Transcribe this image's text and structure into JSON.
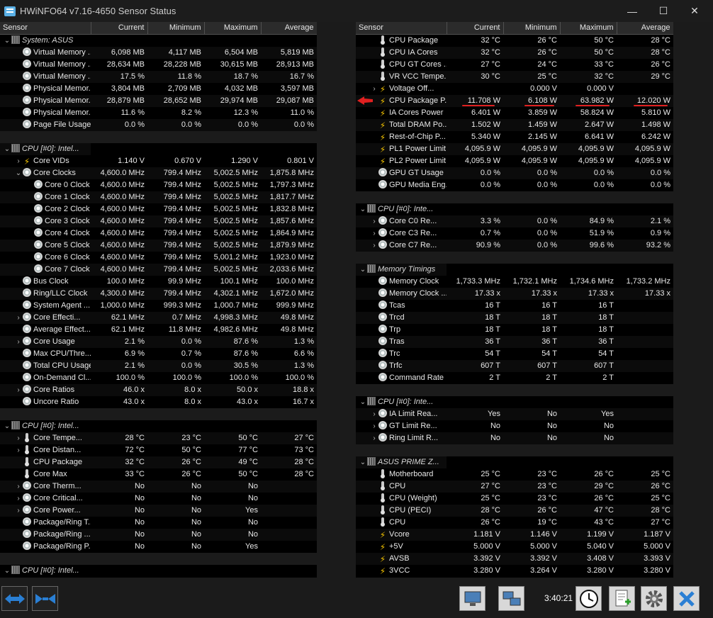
{
  "window": {
    "title": "HWiNFO64 v7.16-4650 Sensor Status",
    "minimize": "—",
    "maximize": "☐",
    "close": "✕"
  },
  "columns": [
    "Sensor",
    "Current",
    "Minimum",
    "Maximum",
    "Average"
  ],
  "left_rows": [
    {
      "t": "group",
      "name": "System: ASUS",
      "icon": "chip-icon",
      "ex": "v"
    },
    {
      "name": "Virtual Memory ...",
      "icon": "clock-icon",
      "indent": 1,
      "v": [
        "6,098 MB",
        "4,117 MB",
        "6,504 MB",
        "5,819 MB"
      ]
    },
    {
      "name": "Virtual Memory ...",
      "icon": "clock-icon",
      "indent": 1,
      "v": [
        "28,634 MB",
        "28,228 MB",
        "30,615 MB",
        "28,913 MB"
      ]
    },
    {
      "name": "Virtual Memory ...",
      "icon": "clock-icon",
      "indent": 1,
      "v": [
        "17.5 %",
        "11.8 %",
        "18.7 %",
        "16.7 %"
      ]
    },
    {
      "name": "Physical Memor...",
      "icon": "clock-icon",
      "indent": 1,
      "v": [
        "3,804 MB",
        "2,709 MB",
        "4,032 MB",
        "3,597 MB"
      ]
    },
    {
      "name": "Physical Memor...",
      "icon": "clock-icon",
      "indent": 1,
      "v": [
        "28,879 MB",
        "28,652 MB",
        "29,974 MB",
        "29,087 MB"
      ]
    },
    {
      "name": "Physical Memor...",
      "icon": "clock-icon",
      "indent": 1,
      "v": [
        "11.6 %",
        "8.2 %",
        "12.3 %",
        "11.0 %"
      ]
    },
    {
      "name": "Page File Usage",
      "icon": "clock-icon",
      "indent": 1,
      "v": [
        "0.0 %",
        "0.0 %",
        "0.0 %",
        "0.0 %"
      ]
    },
    {
      "t": "sep"
    },
    {
      "t": "group",
      "name": "CPU [#0]: Intel...",
      "icon": "chip-icon",
      "ex": "v"
    },
    {
      "name": "Core VIDs",
      "icon": "bolt-icon",
      "indent": 1,
      "ex": ">",
      "v": [
        "1.140 V",
        "0.670 V",
        "1.290 V",
        "0.801 V"
      ]
    },
    {
      "name": "Core Clocks",
      "icon": "clock-icon",
      "indent": 1,
      "ex": "v",
      "v": [
        "4,600.0 MHz",
        "799.4 MHz",
        "5,002.5 MHz",
        "1,875.8 MHz"
      ]
    },
    {
      "name": "Core 0 Clock",
      "icon": "clock-icon",
      "indent": 2,
      "v": [
        "4,600.0 MHz",
        "799.4 MHz",
        "5,002.5 MHz",
        "1,797.3 MHz"
      ]
    },
    {
      "name": "Core 1 Clock",
      "icon": "clock-icon",
      "indent": 2,
      "v": [
        "4,600.0 MHz",
        "799.4 MHz",
        "5,002.5 MHz",
        "1,817.7 MHz"
      ]
    },
    {
      "name": "Core 2 Clock",
      "icon": "clock-icon",
      "indent": 2,
      "v": [
        "4,600.0 MHz",
        "799.4 MHz",
        "5,002.5 MHz",
        "1,832.8 MHz"
      ]
    },
    {
      "name": "Core 3 Clock",
      "icon": "clock-icon",
      "indent": 2,
      "v": [
        "4,600.0 MHz",
        "799.4 MHz",
        "5,002.5 MHz",
        "1,857.6 MHz"
      ]
    },
    {
      "name": "Core 4 Clock",
      "icon": "clock-icon",
      "indent": 2,
      "v": [
        "4,600.0 MHz",
        "799.4 MHz",
        "5,002.5 MHz",
        "1,864.9 MHz"
      ]
    },
    {
      "name": "Core 5 Clock",
      "icon": "clock-icon",
      "indent": 2,
      "v": [
        "4,600.0 MHz",
        "799.4 MHz",
        "5,002.5 MHz",
        "1,879.9 MHz"
      ]
    },
    {
      "name": "Core 6 Clock",
      "icon": "clock-icon",
      "indent": 2,
      "v": [
        "4,600.0 MHz",
        "799.4 MHz",
        "5,001.2 MHz",
        "1,923.0 MHz"
      ]
    },
    {
      "name": "Core 7 Clock",
      "icon": "clock-icon",
      "indent": 2,
      "v": [
        "4,600.0 MHz",
        "799.4 MHz",
        "5,002.5 MHz",
        "2,033.6 MHz"
      ]
    },
    {
      "name": "Bus Clock",
      "icon": "clock-icon",
      "indent": 1,
      "v": [
        "100.0 MHz",
        "99.9 MHz",
        "100.1 MHz",
        "100.0 MHz"
      ]
    },
    {
      "name": "Ring/LLC Clock",
      "icon": "clock-icon",
      "indent": 1,
      "v": [
        "4,300.0 MHz",
        "799.4 MHz",
        "4,302.1 MHz",
        "1,672.0 MHz"
      ]
    },
    {
      "name": "System Agent ...",
      "icon": "clock-icon",
      "indent": 1,
      "v": [
        "1,000.0 MHz",
        "999.3 MHz",
        "1,000.7 MHz",
        "999.9 MHz"
      ]
    },
    {
      "name": "Core Effecti...",
      "icon": "clock-icon",
      "indent": 1,
      "ex": ">",
      "v": [
        "62.1 MHz",
        "0.7 MHz",
        "4,998.3 MHz",
        "49.8 MHz"
      ]
    },
    {
      "name": "Average Effect...",
      "icon": "clock-icon",
      "indent": 1,
      "v": [
        "62.1 MHz",
        "11.8 MHz",
        "4,982.6 MHz",
        "49.8 MHz"
      ]
    },
    {
      "name": "Core Usage",
      "icon": "clock-icon",
      "indent": 1,
      "ex": ">",
      "v": [
        "2.1 %",
        "0.0 %",
        "87.6 %",
        "1.3 %"
      ]
    },
    {
      "name": "Max CPU/Thre...",
      "icon": "clock-icon",
      "indent": 1,
      "v": [
        "6.9 %",
        "0.7 %",
        "87.6 %",
        "6.6 %"
      ]
    },
    {
      "name": "Total CPU Usage",
      "icon": "clock-icon",
      "indent": 1,
      "v": [
        "2.1 %",
        "0.0 %",
        "30.5 %",
        "1.3 %"
      ]
    },
    {
      "name": "On-Demand Cl...",
      "icon": "clock-icon",
      "indent": 1,
      "v": [
        "100.0 %",
        "100.0 %",
        "100.0 %",
        "100.0 %"
      ]
    },
    {
      "name": "Core Ratios",
      "icon": "clock-icon",
      "indent": 1,
      "ex": ">",
      "v": [
        "46.0 x",
        "8.0 x",
        "50.0 x",
        "18.8 x"
      ]
    },
    {
      "name": "Uncore Ratio",
      "icon": "clock-icon",
      "indent": 1,
      "v": [
        "43.0 x",
        "8.0 x",
        "43.0 x",
        "16.7 x"
      ]
    },
    {
      "t": "sep"
    },
    {
      "t": "group",
      "name": "CPU [#0]: Intel...",
      "icon": "chip-icon",
      "ex": "v"
    },
    {
      "name": "Core Tempe...",
      "icon": "therm-icon",
      "indent": 1,
      "ex": ">",
      "v": [
        "28 °C",
        "23 °C",
        "50 °C",
        "27 °C"
      ]
    },
    {
      "name": "Core Distan...",
      "icon": "therm-icon",
      "indent": 1,
      "ex": ">",
      "v": [
        "72 °C",
        "50 °C",
        "77 °C",
        "73 °C"
      ]
    },
    {
      "name": "CPU Package",
      "icon": "therm-icon",
      "indent": 1,
      "v": [
        "32 °C",
        "26 °C",
        "49 °C",
        "28 °C"
      ]
    },
    {
      "name": "Core Max",
      "icon": "therm-icon",
      "indent": 1,
      "v": [
        "33 °C",
        "26 °C",
        "50 °C",
        "28 °C"
      ]
    },
    {
      "name": "Core Therm...",
      "icon": "clock-icon",
      "indent": 1,
      "ex": ">",
      "v": [
        "No",
        "No",
        "No",
        ""
      ]
    },
    {
      "name": "Core Critical...",
      "icon": "clock-icon",
      "indent": 1,
      "ex": ">",
      "v": [
        "No",
        "No",
        "No",
        ""
      ]
    },
    {
      "name": "Core Power...",
      "icon": "clock-icon",
      "indent": 1,
      "ex": ">",
      "v": [
        "No",
        "No",
        "Yes",
        ""
      ]
    },
    {
      "name": "Package/Ring T...",
      "icon": "clock-icon",
      "indent": 1,
      "v": [
        "No",
        "No",
        "No",
        ""
      ]
    },
    {
      "name": "Package/Ring ...",
      "icon": "clock-icon",
      "indent": 1,
      "v": [
        "No",
        "No",
        "No",
        ""
      ]
    },
    {
      "name": "Package/Ring P...",
      "icon": "clock-icon",
      "indent": 1,
      "v": [
        "No",
        "No",
        "Yes",
        ""
      ]
    },
    {
      "t": "sep"
    },
    {
      "t": "group",
      "name": "CPU [#0]: Intel...",
      "icon": "chip-icon",
      "ex": "v"
    }
  ],
  "right_rows": [
    {
      "name": "CPU Package",
      "icon": "therm-icon",
      "indent": 1,
      "v": [
        "32 °C",
        "26 °C",
        "50 °C",
        "28 °C"
      ]
    },
    {
      "name": "CPU IA Cores",
      "icon": "therm-icon",
      "indent": 1,
      "v": [
        "32 °C",
        "26 °C",
        "50 °C",
        "28 °C"
      ]
    },
    {
      "name": "CPU GT Cores ...",
      "icon": "therm-icon",
      "indent": 1,
      "v": [
        "27 °C",
        "24 °C",
        "33 °C",
        "26 °C"
      ]
    },
    {
      "name": "VR VCC Tempe...",
      "icon": "therm-icon",
      "indent": 1,
      "v": [
        "30 °C",
        "25 °C",
        "32 °C",
        "29 °C"
      ]
    },
    {
      "name": "Voltage Off...",
      "icon": "bolt-icon",
      "indent": 1,
      "ex": ">",
      "v": [
        "",
        "0.000 V",
        "0.000 V",
        ""
      ]
    },
    {
      "name": "CPU Package P...",
      "icon": "bolt-icon",
      "indent": 1,
      "v": [
        "11.708 W",
        "6.108 W",
        "63.982 W",
        "12.020 W"
      ]
    },
    {
      "name": "IA Cores Power",
      "icon": "bolt-icon",
      "indent": 1,
      "v": [
        "6.401 W",
        "3.859 W",
        "58.824 W",
        "5.810 W"
      ]
    },
    {
      "name": "Total DRAM Po...",
      "icon": "bolt-icon",
      "indent": 1,
      "v": [
        "1.502 W",
        "1.459 W",
        "2.647 W",
        "1.498 W"
      ]
    },
    {
      "name": "Rest-of-Chip P...",
      "icon": "bolt-icon",
      "indent": 1,
      "v": [
        "5.340 W",
        "2.145 W",
        "6.641 W",
        "6.242 W"
      ]
    },
    {
      "name": "PL1 Power Limit",
      "icon": "bolt-icon",
      "indent": 1,
      "v": [
        "4,095.9 W",
        "4,095.9 W",
        "4,095.9 W",
        "4,095.9 W"
      ]
    },
    {
      "name": "PL2 Power Limit",
      "icon": "bolt-icon",
      "indent": 1,
      "v": [
        "4,095.9 W",
        "4,095.9 W",
        "4,095.9 W",
        "4,095.9 W"
      ]
    },
    {
      "name": "GPU GT Usage",
      "icon": "clock-icon",
      "indent": 1,
      "v": [
        "0.0 %",
        "0.0 %",
        "0.0 %",
        "0.0 %"
      ]
    },
    {
      "name": "GPU Media Eng...",
      "icon": "clock-icon",
      "indent": 1,
      "v": [
        "0.0 %",
        "0.0 %",
        "0.0 %",
        "0.0 %"
      ]
    },
    {
      "t": "sep"
    },
    {
      "t": "group",
      "name": "CPU [#0]: Inte...",
      "icon": "chip-icon",
      "ex": "v"
    },
    {
      "name": "Core C0 Re...",
      "icon": "clock-icon",
      "indent": 1,
      "ex": ">",
      "v": [
        "3.3 %",
        "0.0 %",
        "84.9 %",
        "2.1 %"
      ]
    },
    {
      "name": "Core C3 Re...",
      "icon": "clock-icon",
      "indent": 1,
      "ex": ">",
      "v": [
        "0.7 %",
        "0.0 %",
        "51.9 %",
        "0.9 %"
      ]
    },
    {
      "name": "Core C7 Re...",
      "icon": "clock-icon",
      "indent": 1,
      "ex": ">",
      "v": [
        "90.9 %",
        "0.0 %",
        "99.6 %",
        "93.2 %"
      ]
    },
    {
      "t": "sep"
    },
    {
      "t": "group",
      "name": "Memory Timings",
      "icon": "chip-icon",
      "ex": "v"
    },
    {
      "name": "Memory Clock",
      "icon": "clock-icon",
      "indent": 1,
      "v": [
        "1,733.3 MHz",
        "1,732.1 MHz",
        "1,734.6 MHz",
        "1,733.2 MHz"
      ]
    },
    {
      "name": "Memory Clock ...",
      "icon": "clock-icon",
      "indent": 1,
      "v": [
        "17.33 x",
        "17.33 x",
        "17.33 x",
        "17.33 x"
      ]
    },
    {
      "name": "Tcas",
      "icon": "clock-icon",
      "indent": 1,
      "v": [
        "16 T",
        "16 T",
        "16 T",
        ""
      ]
    },
    {
      "name": "Trcd",
      "icon": "clock-icon",
      "indent": 1,
      "v": [
        "18 T",
        "18 T",
        "18 T",
        ""
      ]
    },
    {
      "name": "Trp",
      "icon": "clock-icon",
      "indent": 1,
      "v": [
        "18 T",
        "18 T",
        "18 T",
        ""
      ]
    },
    {
      "name": "Tras",
      "icon": "clock-icon",
      "indent": 1,
      "v": [
        "36 T",
        "36 T",
        "36 T",
        ""
      ]
    },
    {
      "name": "Trc",
      "icon": "clock-icon",
      "indent": 1,
      "v": [
        "54 T",
        "54 T",
        "54 T",
        ""
      ]
    },
    {
      "name": "Trfc",
      "icon": "clock-icon",
      "indent": 1,
      "v": [
        "607 T",
        "607 T",
        "607 T",
        ""
      ]
    },
    {
      "name": "Command Rate",
      "icon": "clock-icon",
      "indent": 1,
      "v": [
        "2 T",
        "2 T",
        "2 T",
        ""
      ]
    },
    {
      "t": "sep"
    },
    {
      "t": "group",
      "name": "CPU [#0]: Inte...",
      "icon": "chip-icon",
      "ex": "v"
    },
    {
      "name": "IA Limit Rea...",
      "icon": "clock-icon",
      "indent": 1,
      "ex": ">",
      "v": [
        "Yes",
        "No",
        "Yes",
        ""
      ]
    },
    {
      "name": "GT Limit Re...",
      "icon": "clock-icon",
      "indent": 1,
      "ex": ">",
      "v": [
        "No",
        "No",
        "No",
        ""
      ]
    },
    {
      "name": "Ring Limit R...",
      "icon": "clock-icon",
      "indent": 1,
      "ex": ">",
      "v": [
        "No",
        "No",
        "No",
        ""
      ]
    },
    {
      "t": "sep"
    },
    {
      "t": "group",
      "name": "ASUS PRIME Z...",
      "icon": "chip-icon",
      "ex": "v"
    },
    {
      "name": "Motherboard",
      "icon": "therm-icon",
      "indent": 1,
      "v": [
        "25 °C",
        "23 °C",
        "26 °C",
        "25 °C"
      ]
    },
    {
      "name": "CPU",
      "icon": "therm-icon",
      "indent": 1,
      "v": [
        "27 °C",
        "23 °C",
        "29 °C",
        "26 °C"
      ]
    },
    {
      "name": "CPU (Weight)",
      "icon": "therm-icon",
      "indent": 1,
      "v": [
        "25 °C",
        "23 °C",
        "26 °C",
        "25 °C"
      ]
    },
    {
      "name": "CPU (PECI)",
      "icon": "therm-icon",
      "indent": 1,
      "v": [
        "28 °C",
        "26 °C",
        "47 °C",
        "28 °C"
      ]
    },
    {
      "name": "CPU",
      "icon": "therm-icon",
      "indent": 1,
      "v": [
        "26 °C",
        "19 °C",
        "43 °C",
        "27 °C"
      ]
    },
    {
      "name": "Vcore",
      "icon": "bolt-icon",
      "indent": 1,
      "v": [
        "1.181 V",
        "1.146 V",
        "1.199 V",
        "1.187 V"
      ]
    },
    {
      "name": "+5V",
      "icon": "bolt-icon",
      "indent": 1,
      "v": [
        "5.000 V",
        "5.000 V",
        "5.040 V",
        "5.000 V"
      ]
    },
    {
      "name": "AVSB",
      "icon": "bolt-icon",
      "indent": 1,
      "v": [
        "3.392 V",
        "3.392 V",
        "3.408 V",
        "3.393 V"
      ]
    },
    {
      "name": "3VCC",
      "icon": "bolt-icon",
      "indent": 1,
      "v": [
        "3.280 V",
        "3.264 V",
        "3.280 V",
        "3.280 V"
      ]
    }
  ],
  "statusbar": {
    "time": "3:40:21"
  },
  "colors": {
    "annotation_red": "#e02020",
    "bolt": "#f0c000",
    "button_blue": "#2a7fd4"
  }
}
